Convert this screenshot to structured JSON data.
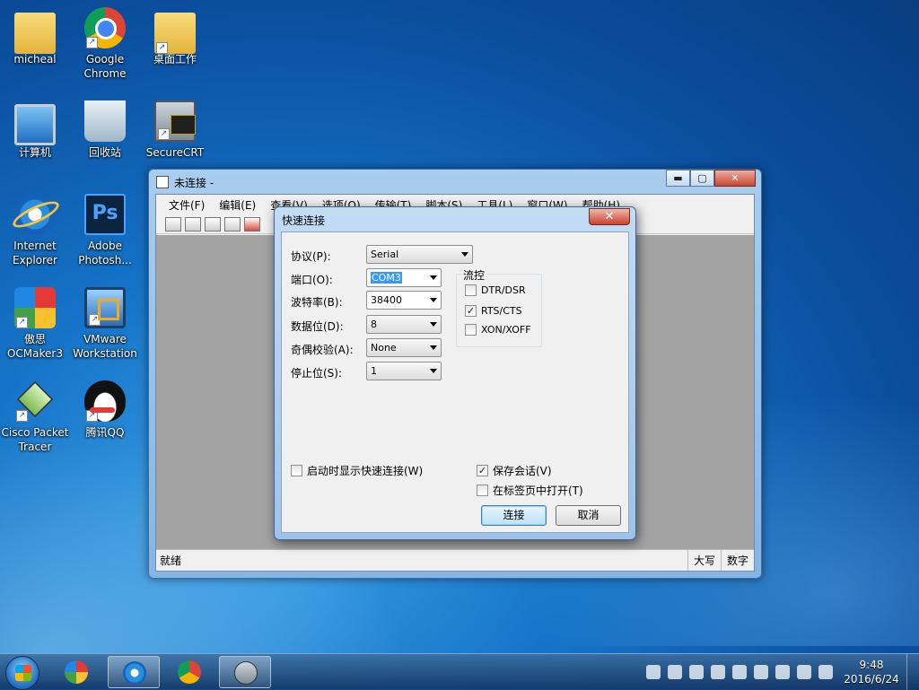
{
  "desktop": {
    "icons": [
      {
        "label": "micheal"
      },
      {
        "label": "Google\nChrome"
      },
      {
        "label": "桌面工作"
      },
      {
        "label": "计算机"
      },
      {
        "label": "回收站"
      },
      {
        "label": "SecureCRT"
      },
      {
        "label": "Internet\nExplorer"
      },
      {
        "label": "Adobe\nPhotosh..."
      },
      {
        "label": "傲思\nOCMaker3"
      },
      {
        "label": "VMware\nWorkstation"
      },
      {
        "label": "Cisco Packet\nTracer"
      },
      {
        "label": "腾讯QQ"
      }
    ],
    "ps_glyph": "Ps",
    "shortcut_glyph": "↗"
  },
  "crt_window": {
    "title": "未连接 -",
    "min_glyph": "▬",
    "max_glyph": "▢",
    "close_glyph": "✕",
    "menu": [
      "文件(F)",
      "编辑(E)",
      "查看(V)",
      "选项(O)",
      "传输(T)",
      "脚本(S)",
      "工具(L)",
      "窗口(W)",
      "帮助(H)"
    ],
    "status": {
      "left": "就绪",
      "caps": "大写",
      "num": "数字"
    }
  },
  "dialog": {
    "title": "快速连接",
    "close_glyph": "✕",
    "fields": {
      "protocol_label": "协议(P):",
      "protocol_value": "Serial",
      "port_label": "端口(O):",
      "port_value": "COM3",
      "baud_label": "波特率(B):",
      "baud_value": "38400",
      "databits_label": "数据位(D):",
      "databits_value": "8",
      "parity_label": "奇偶校验(A):",
      "parity_value": "None",
      "stopbits_label": "停止位(S):",
      "stopbits_value": "1"
    },
    "flow": {
      "title": "流控",
      "dtr": {
        "label": "DTR/DSR",
        "checked": false
      },
      "rts": {
        "label": "RTS/CTS",
        "checked": true
      },
      "xon": {
        "label": "XON/XOFF",
        "checked": false
      }
    },
    "show_on_startup": {
      "label": "启动时显示快速连接(W)",
      "checked": false
    },
    "save_session": {
      "label": "保存会话(V)",
      "checked": true
    },
    "open_in_tab": {
      "label": "在标签页中打开(T)",
      "checked": false
    },
    "connect_label": "连接",
    "cancel_label": "取消",
    "check_glyph": "✓"
  },
  "taskbar": {
    "clock_time": "9:48",
    "clock_date": "2016/6/24"
  }
}
